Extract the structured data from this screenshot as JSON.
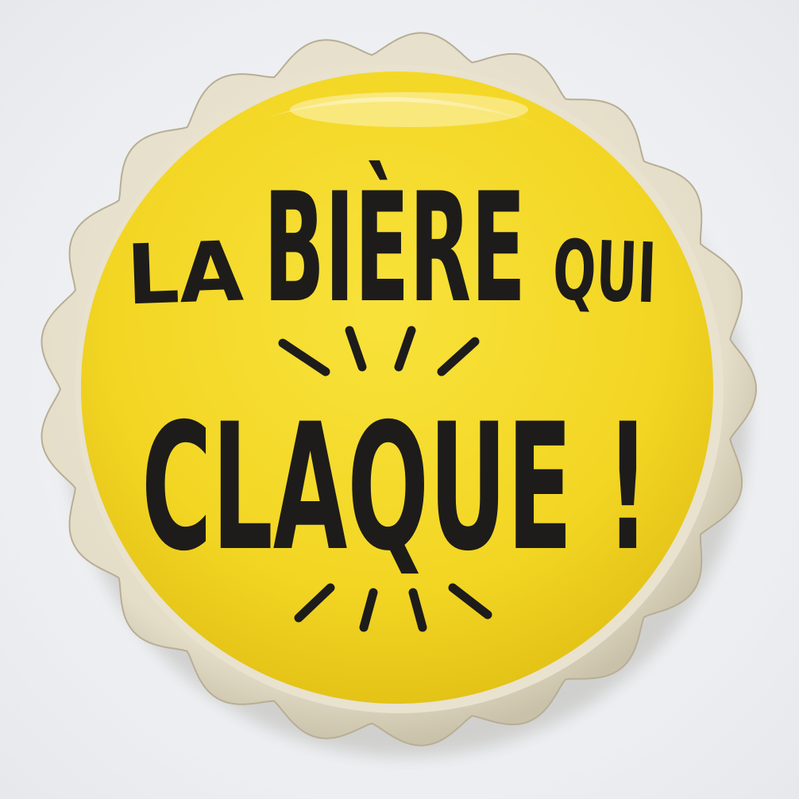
{
  "cap": {
    "line1_left": "LA",
    "line1_main": "BIÈRE",
    "line1_right": "QUI",
    "line2": "CLAQUE !"
  },
  "colors": {
    "background": "#f1f2f4",
    "cap_face": "#f5dc2a",
    "cap_face_shadow": "#e9c919",
    "cap_rim": "#e7e1cf",
    "ink": "#1d1c1a"
  }
}
